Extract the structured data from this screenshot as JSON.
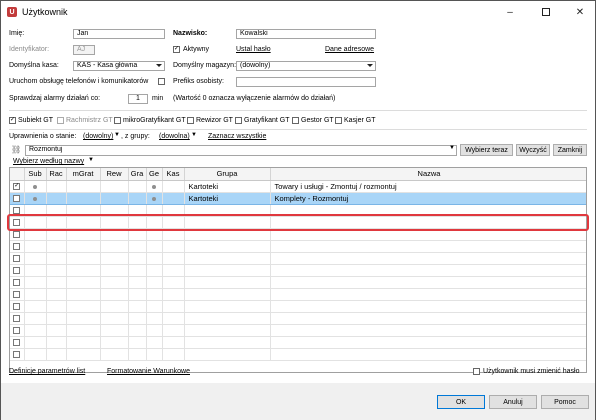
{
  "window": {
    "title": "Użytkownik",
    "icon_letter": "U"
  },
  "form": {
    "imie_label": "Imię:",
    "imie_value": "Jan",
    "nazwisko_label": "Nazwisko:",
    "nazwisko_value": "Kowalski",
    "identyfikator_label": "Identyfikator:",
    "identyfikator_value": "AJ",
    "aktywny_label": "Aktywny",
    "ustal_haslo": "Ustal hasło",
    "dane_adresowe": "Dane adresowe",
    "kasa_label": "Domyślna kasa:",
    "kasa_value": "KAS - Kasa główna",
    "magazyn_label": "Domyślny magazyn:",
    "magazyn_value": "(dowolny)",
    "uruchom_label": "Uruchom obsługę telefonów i komunikatorów",
    "prefiks_label": "Prefiks osobisty:",
    "prefiks_value": "",
    "alarmy_label": "Sprawdzaj alarmy działań co:",
    "alarmy_value": "1",
    "alarmy_unit": "min",
    "alarmy_note": "(Wartość 0 oznacza wyłączenie alarmów do działań)"
  },
  "programs": [
    {
      "label": "Subiekt GT",
      "checked": true,
      "disabled": false
    },
    {
      "label": "Rachmistrz GT",
      "checked": false,
      "disabled": true
    },
    {
      "label": "mikroGratyfikant GT",
      "checked": false,
      "disabled": false
    },
    {
      "label": "Rewizor GT",
      "checked": false,
      "disabled": false
    },
    {
      "label": "Gratyfikant GT",
      "checked": false,
      "disabled": false
    },
    {
      "label": "Gestor GT",
      "checked": false,
      "disabled": false
    },
    {
      "label": "Kasjer GT",
      "checked": false,
      "disabled": false
    }
  ],
  "permissions": {
    "label": "Uprawnienia o stanie:",
    "state_value": "(dowolny)",
    "group_label": ", z grupy:",
    "group_value": "(dowolna)",
    "mark_all": "Zaznacz wszystkie",
    "search_value": "Rozmontuj",
    "choose_btn": "Wybierz teraz",
    "clear_btn": "Wyczyść",
    "close_btn": "Zamknij",
    "sort_label": "Wybierz według nazwy"
  },
  "grid": {
    "columns": [
      "",
      "Sub",
      "Rac",
      "mGrat",
      "Rew",
      "Gra",
      "Ge",
      "Kas",
      "Grupa",
      "Nazwa"
    ],
    "rows": [
      {
        "checked": true,
        "sub": true,
        "ge": true,
        "grupa": "Kartoteki",
        "nazwa": "Towary i usługi - Zmontuj / rozmontuj",
        "selected": false
      },
      {
        "checked": false,
        "sub": true,
        "ge": true,
        "grupa": "Kartoteki",
        "nazwa": "Komplety - Rozmontuj",
        "selected": true
      }
    ],
    "empty_rows": 13
  },
  "links": {
    "definicje": "Definicje parametrów list",
    "formatowanie": "Formatowanie Warunkowe"
  },
  "must_change": "Użytkownik musi zmienić hasło",
  "footer": {
    "ok": "OK",
    "anuluj": "Anuluj",
    "pomoc": "Pomoc"
  }
}
